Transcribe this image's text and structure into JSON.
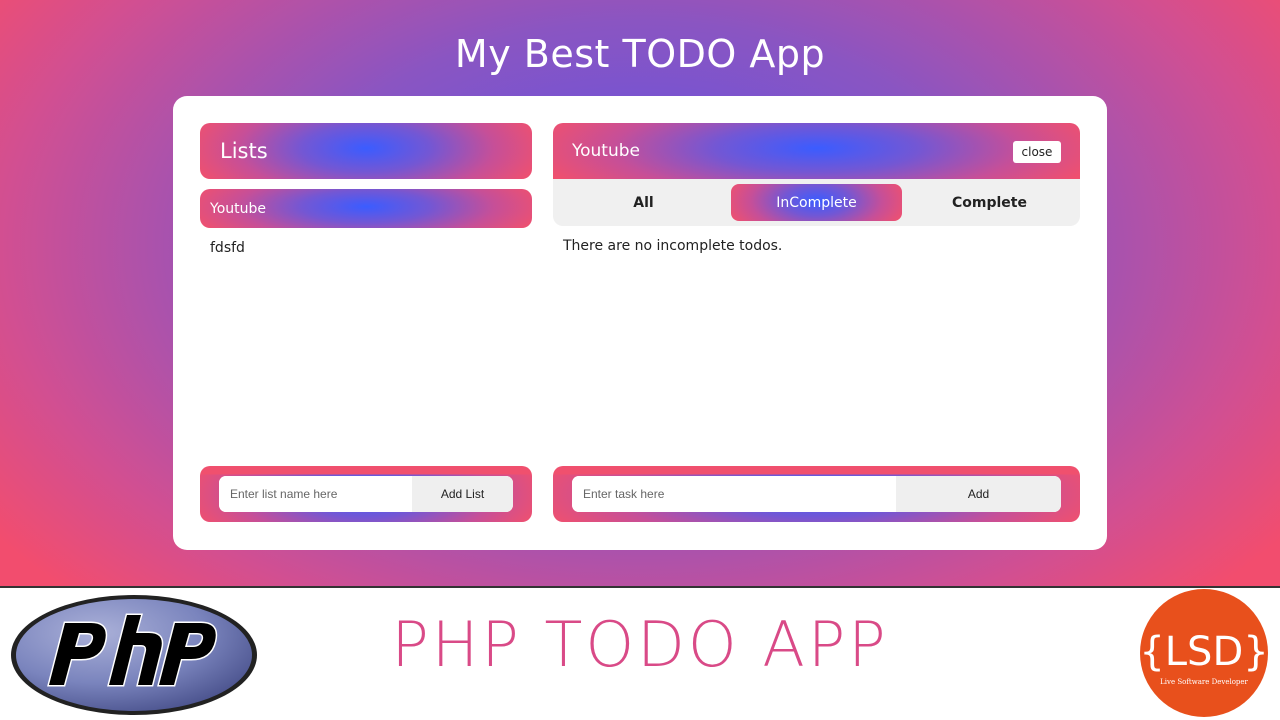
{
  "app_title": "My Best TODO App",
  "lists_panel": {
    "header": "Lists",
    "items": [
      {
        "label": "Youtube",
        "active": true
      },
      {
        "label": "fdsfd",
        "active": false
      }
    ],
    "input_placeholder": "Enter list name here",
    "add_button": "Add List"
  },
  "todo_panel": {
    "header": "Youtube",
    "close_button": "close",
    "tabs": [
      {
        "label": "All",
        "active": false
      },
      {
        "label": "InComplete",
        "active": true
      },
      {
        "label": "Complete",
        "active": false
      }
    ],
    "empty_message": "There are no incomplete todos.",
    "input_placeholder": "Enter task here",
    "add_button": "Add"
  },
  "banner": {
    "title": "PHP TODO APP",
    "left_logo": "php",
    "right_logo_text": "{LSD}",
    "right_logo_subtext": "Live Software Developer"
  },
  "colors": {
    "accent_pink": "#f0506e",
    "accent_blue": "#3b5cff",
    "banner_title": "#d94a87",
    "lsd_orange": "#e8501c"
  }
}
